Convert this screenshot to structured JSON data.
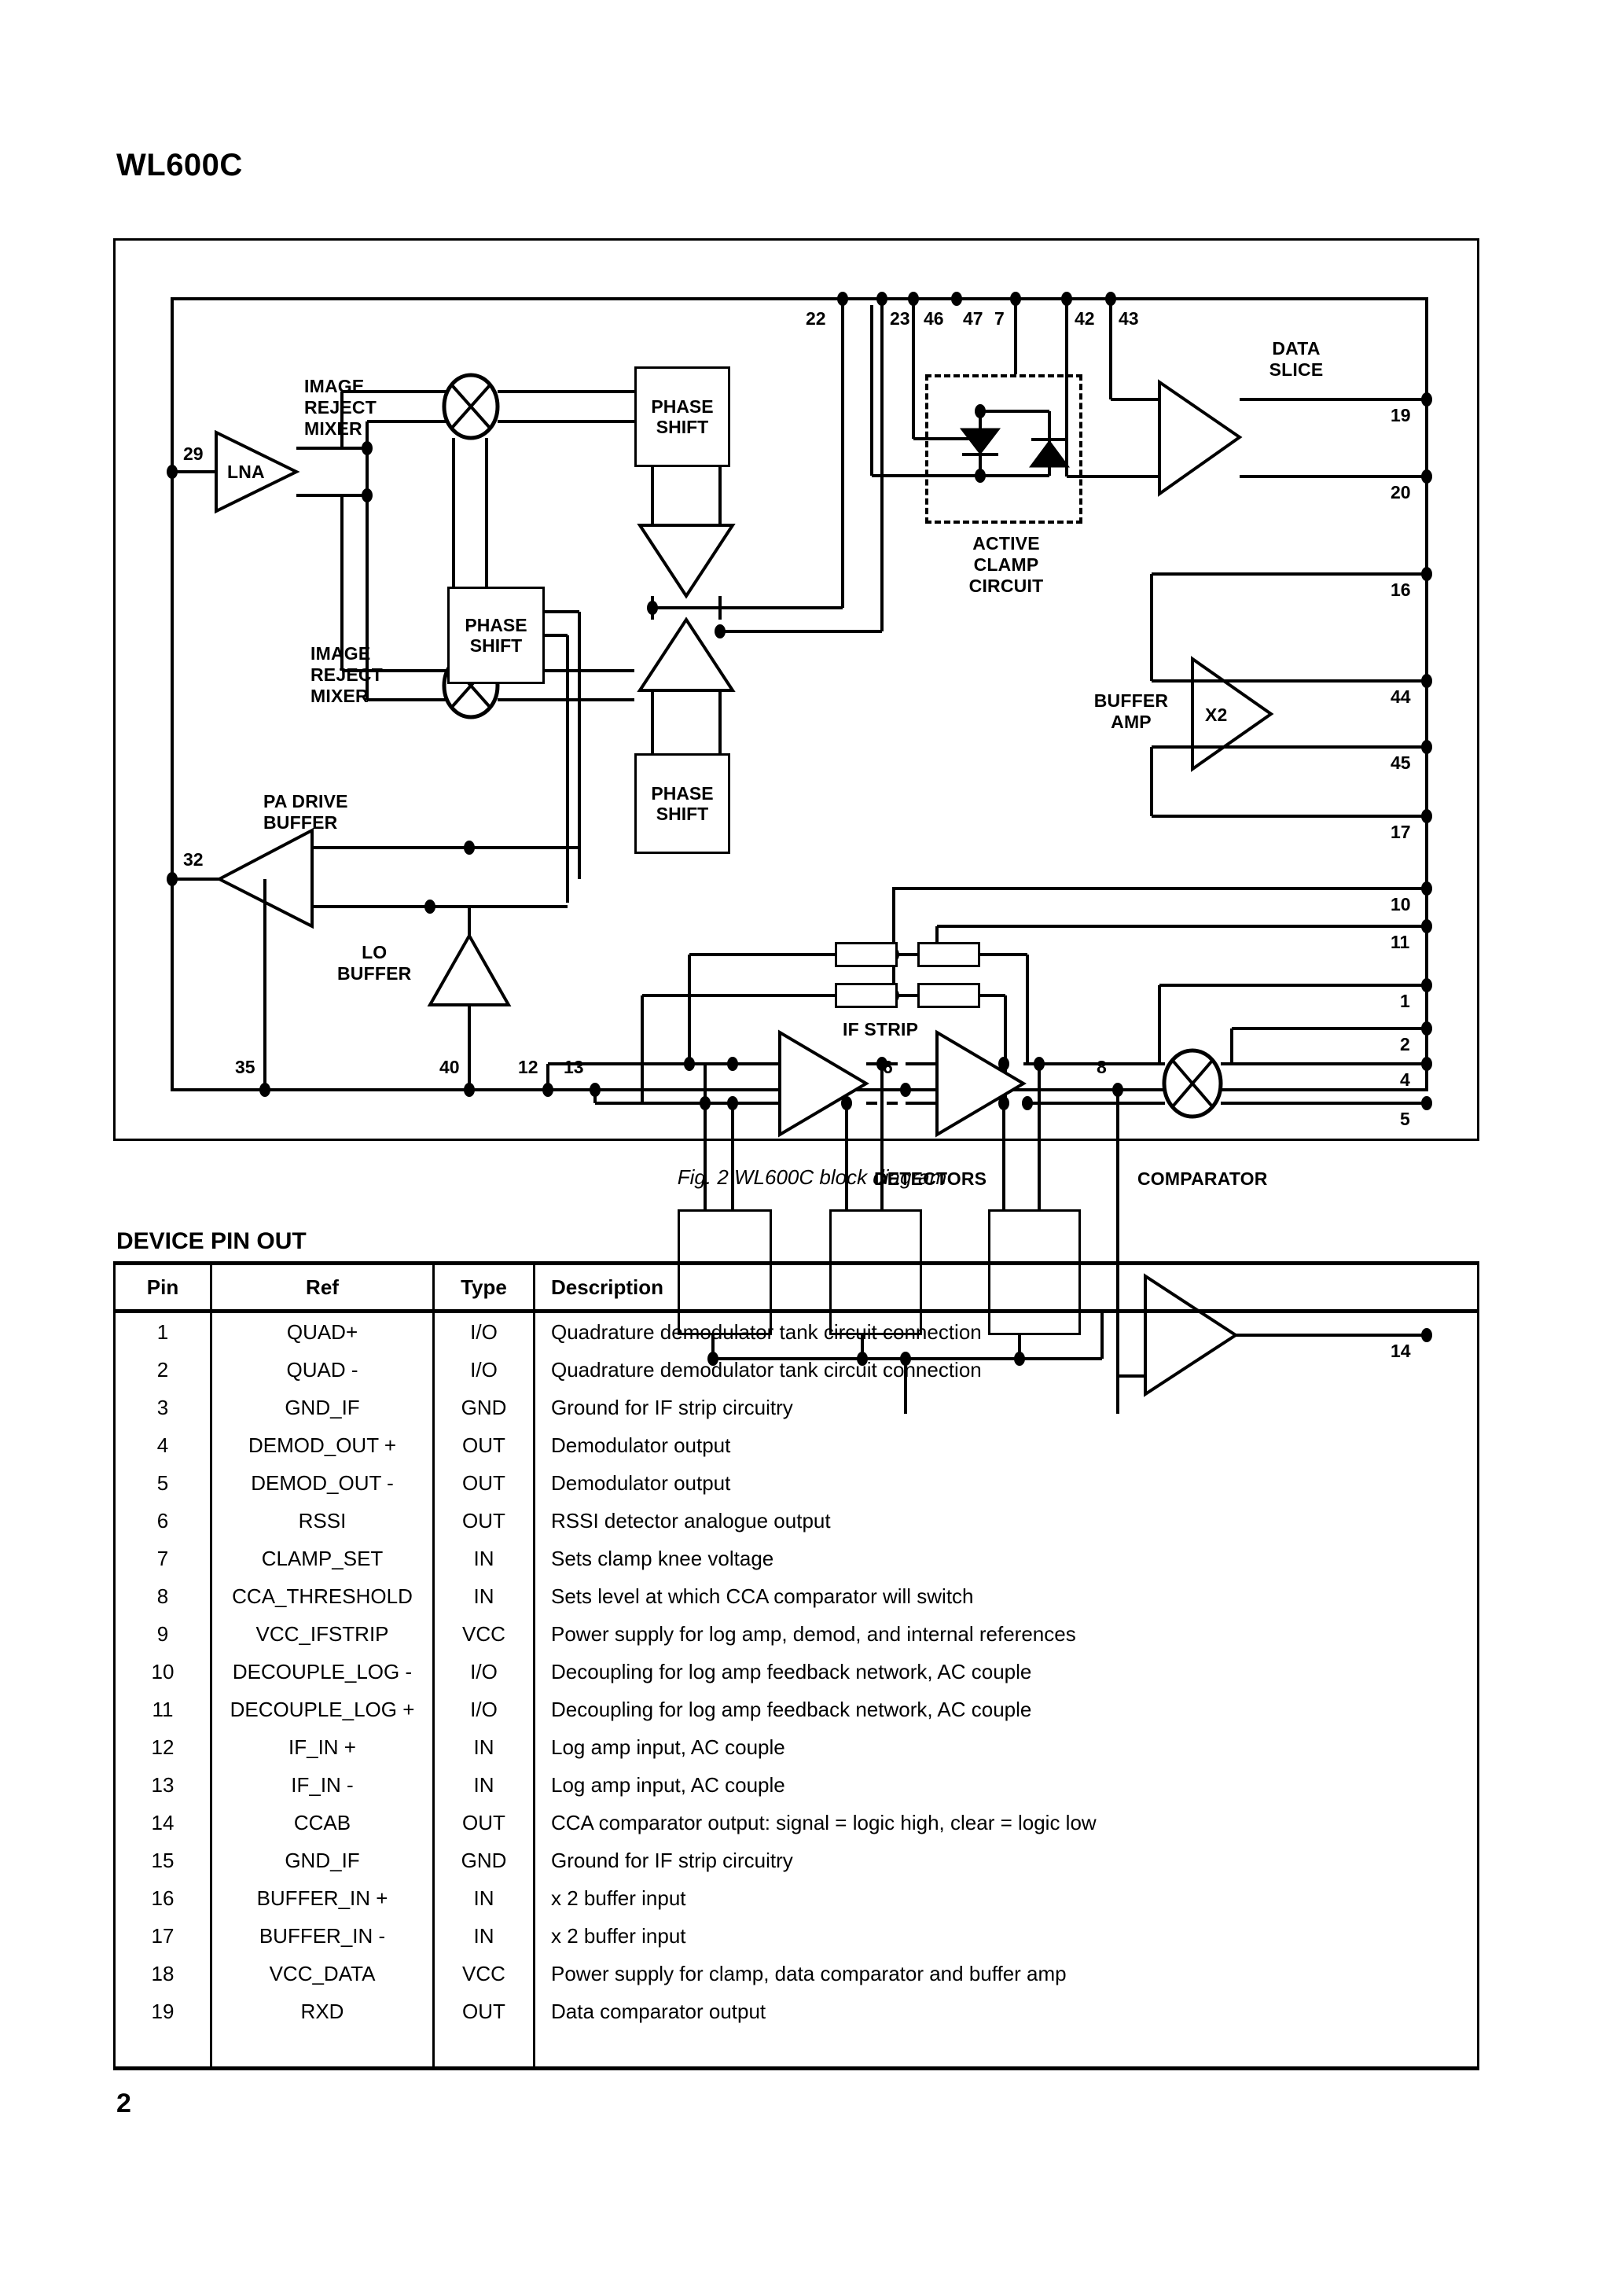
{
  "document": {
    "title": "WL600C",
    "page_number": "2"
  },
  "figure": {
    "caption": "Fig. 2 WL600C block diagram",
    "labels": {
      "image_reject_mixer_top": "IMAGE\nREJECT\nMIXER",
      "image_reject_mixer_bottom": "IMAGE\nREJECT\nMIXER",
      "lna": "LNA",
      "phase_shift_1": "PHASE\nSHIFT",
      "phase_shift_2": "PHASE\nSHIFT",
      "phase_shift_3": "PHASE\nSHIFT",
      "phase_shift_4": "PHASE\nSHIFT",
      "pa_drive_buffer": "PA DRIVE\nBUFFER",
      "lo_buffer": "LO\nBUFFER",
      "active_clamp_circuit": "ACTIVE\nCLAMP\nCIRCUIT",
      "data_slice": "DATA\nSLICE",
      "buffer_amp": "BUFFER\nAMP",
      "buffer_amp_gain": "X2",
      "if_strip": "IF STRIP",
      "detectors": "DETECTORS",
      "comparator": "COMPARATOR"
    },
    "pins_top": [
      "22",
      "23",
      "46",
      "47",
      "7",
      "42",
      "43"
    ],
    "pins_right": [
      "19",
      "20",
      "16",
      "44",
      "45",
      "17",
      "10",
      "11",
      "1",
      "2",
      "4",
      "5",
      "14"
    ],
    "pins_left": [
      "29",
      "32"
    ],
    "pins_bottom": [
      "35",
      "40",
      "12",
      "13",
      "6",
      "8"
    ]
  },
  "pinout": {
    "section_title": "DEVICE PIN OUT",
    "headers": [
      "Pin",
      "Ref",
      "Type",
      "Description"
    ],
    "rows": [
      {
        "pin": "1",
        "ref": "QUAD+",
        "type": "I/O",
        "desc": "Quadrature demodulator tank circuit connection"
      },
      {
        "pin": "2",
        "ref": "QUAD -",
        "type": "I/O",
        "desc": "Quadrature demodulator tank circuit connection"
      },
      {
        "pin": "3",
        "ref": "GND_IF",
        "type": "GND",
        "desc": "Ground for IF strip circuitry"
      },
      {
        "pin": "4",
        "ref": "DEMOD_OUT +",
        "type": "OUT",
        "desc": "Demodulator output"
      },
      {
        "pin": "5",
        "ref": "DEMOD_OUT -",
        "type": "OUT",
        "desc": "Demodulator output"
      },
      {
        "pin": "6",
        "ref": "RSSI",
        "type": "OUT",
        "desc": "RSSI detector analogue output"
      },
      {
        "pin": "7",
        "ref": "CLAMP_SET",
        "type": "IN",
        "desc": "Sets clamp knee voltage"
      },
      {
        "pin": "8",
        "ref": "CCA_THRESHOLD",
        "type": "IN",
        "desc": "Sets level at which CCA comparator will switch"
      },
      {
        "pin": "9",
        "ref": "VCC_IFSTRIP",
        "type": "VCC",
        "desc": "Power supply for log amp, demod, and internal references"
      },
      {
        "pin": "10",
        "ref": "DECOUPLE_LOG -",
        "type": "I/O",
        "desc": "Decoupling for log amp feedback network, AC couple"
      },
      {
        "pin": "11",
        "ref": "DECOUPLE_LOG +",
        "type": "I/O",
        "desc": "Decoupling for log amp feedback network, AC couple"
      },
      {
        "pin": "12",
        "ref": "IF_IN +",
        "type": "IN",
        "desc": "Log amp input, AC couple"
      },
      {
        "pin": "13",
        "ref": "IF_IN -",
        "type": "IN",
        "desc": "Log amp input, AC couple"
      },
      {
        "pin": "14",
        "ref": "CCAB",
        "type": "OUT",
        "desc": "CCA comparator output: signal = logic high, clear = logic low"
      },
      {
        "pin": "15",
        "ref": "GND_IF",
        "type": "GND",
        "desc": "Ground for IF strip circuitry"
      },
      {
        "pin": "16",
        "ref": "BUFFER_IN +",
        "type": "IN",
        "desc": "x 2 buffer input"
      },
      {
        "pin": "17",
        "ref": "BUFFER_IN -",
        "type": "IN",
        "desc": "x 2 buffer input"
      },
      {
        "pin": "18",
        "ref": "VCC_DATA",
        "type": "VCC",
        "desc": "Power supply for clamp, data comparator and buffer amp"
      },
      {
        "pin": "19",
        "ref": "RXD",
        "type": "OUT",
        "desc": "Data comparator output"
      }
    ]
  }
}
